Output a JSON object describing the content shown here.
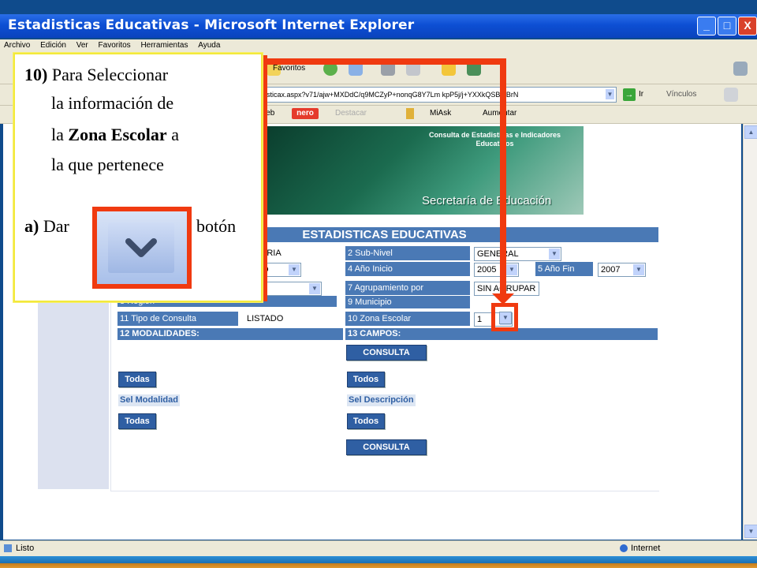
{
  "window": {
    "title": "Estadisticas Educativas - Microsoft Internet Explorer",
    "controls": {
      "minimize": "_",
      "maximize": "□",
      "close": "X"
    }
  },
  "menu": [
    "Archivo",
    "Edición",
    "Ver",
    "Favoritos",
    "Herramientas",
    "Ayuda"
  ],
  "toolbar": {
    "favorites": "Favoritos",
    "address": "adisticax.aspx?v71/ajw+MXDdC/q9MCZyP+nonqG8Y7Lm kpP5j/j+YXXkQSBetBrN",
    "go": "Ir",
    "links": "Vínculos",
    "web_label": "web",
    "nero": "nero",
    "highlight": "Destacar",
    "miask": "MiAsk",
    "zoom": "Aumentar"
  },
  "banner": {
    "heading": "Consulta de Estadisticas e Indicadores Educativos",
    "secretaria": "Secretaría de Educación"
  },
  "form": {
    "title": "ESTADISTICAS EDUCATIVAS",
    "rows": {
      "r1": {
        "left_value": "ARIA",
        "right_label": "2 Sub-Nivel",
        "right_value": "GENERAL"
      },
      "r2": {
        "left_value": "IO",
        "right_label": "4 Año Inicio",
        "right_value": "2005",
        "extra_label": "5 Año Fin",
        "extra_value": "2007"
      },
      "r3": {
        "left_value": "A",
        "right_label": "7 Agrupamiento por",
        "right_value": "SIN AGRUPAR"
      },
      "r4": {
        "left_label": "8 Region",
        "right_label": "9 Municipio"
      },
      "r5": {
        "left_label": "11 Tipo de Consulta",
        "left_value": "LISTADO",
        "right_label": "10 Zona Escolar",
        "right_value": "1"
      }
    },
    "modalidades_label": "12 MODALIDADES:",
    "campos_label": "13 CAMPOS:",
    "consulta": "CONSULTA",
    "todas": "Todas",
    "todos": "Todos",
    "sel_modalidad": "Sel Modalidad",
    "sel_descripcion": "Sel Descripción"
  },
  "status": {
    "left": "Listo",
    "right": "Internet"
  },
  "callout": {
    "step": "10)",
    "text1": "Para Seleccionar",
    "text2": "la información de",
    "text3_pre": "la",
    "text3_bold": "Zona Escolar",
    "text3_post": "a",
    "text4": "la que pertenece",
    "sub": "a)",
    "sub_pre": "Dar",
    "sub_post": "botón"
  }
}
